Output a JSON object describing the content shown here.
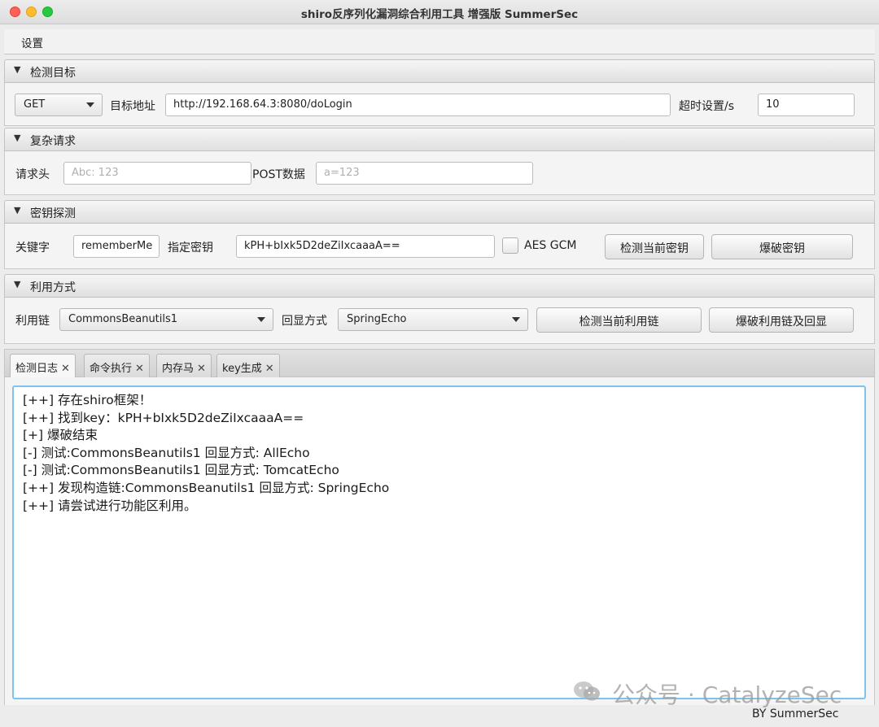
{
  "window": {
    "title": "shiro反序列化漏洞综合利用工具 增强版 SummerSec"
  },
  "menu": {
    "settings": "设置"
  },
  "detect_target": {
    "title": "检测目标",
    "method": "GET",
    "url_label": "目标地址",
    "url_value": "http://192.168.64.3:8080/doLogin",
    "timeout_label": "超时设置/s",
    "timeout_value": "10"
  },
  "complex_request": {
    "title": "复杂请求",
    "header_label": "请求头",
    "header_placeholder": "Abc: 123",
    "post_label": "POST数据",
    "post_placeholder": "a=123"
  },
  "key_detect": {
    "title": "密钥探测",
    "keyword_label": "关键字",
    "keyword_value": "rememberMe",
    "key_label": "指定密钥",
    "key_value": "kPH+bIxk5D2deZiIxcaaaA==",
    "aes_gcm_label": "AES GCM",
    "aes_gcm_checked": false,
    "check_key_button": "检测当前密钥",
    "brute_key_button": "爆破密钥"
  },
  "exploit": {
    "title": "利用方式",
    "chain_label": "利用链",
    "chain_value": "CommonsBeanutils1",
    "echo_label": "回显方式",
    "echo_value": "SpringEcho",
    "check_chain_button": "检测当前利用链",
    "brute_chain_button": "爆破利用链及回显"
  },
  "tabs": [
    {
      "label": "检测日志",
      "close": "✕"
    },
    {
      "label": "命令执行",
      "close": "✕"
    },
    {
      "label": "内存马",
      "close": "✕"
    },
    {
      "label": "key生成",
      "close": "✕"
    }
  ],
  "log_lines": [
    "[++] 存在shiro框架！",
    "[++] 找到key：kPH+bIxk5D2deZiIxcaaaA==",
    "[+] 爆破结束",
    "[-] 测试:CommonsBeanutils1  回显方式: AllEcho",
    "[-] 测试:CommonsBeanutils1  回显方式: TomcatEcho",
    "[++] 发现构造链:CommonsBeanutils1  回显方式: SpringEcho",
    "[++] 请尝试进行功能区利用。"
  ],
  "watermark": "公众号 · CatalyzeSec",
  "footer": "BY  SummerSec"
}
